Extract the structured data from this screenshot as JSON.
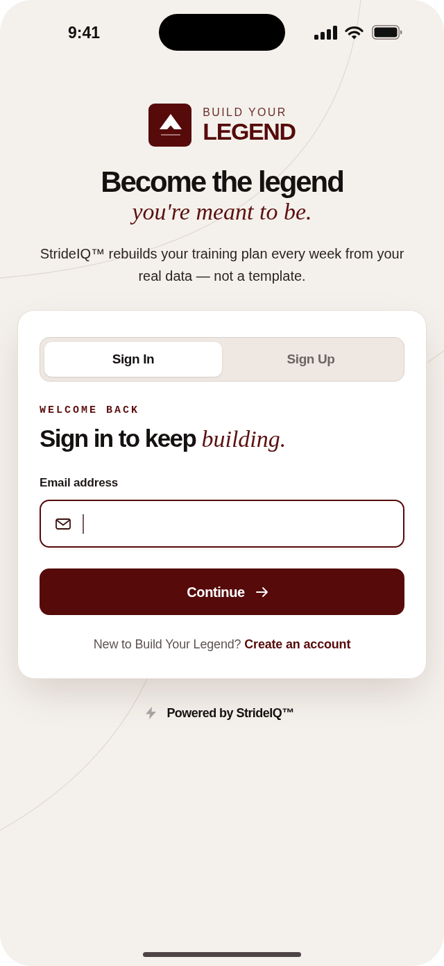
{
  "status_bar": {
    "time": "9:41"
  },
  "brand": {
    "eyebrow": "BUILD YOUR",
    "name": "LEGEND"
  },
  "hero": {
    "headline": "Become the legend",
    "tagline": "you're meant to be.",
    "description": "StrideIQ™ rebuilds your training plan every week from your real data — not a template."
  },
  "auth_card": {
    "tabs": [
      {
        "label": "Sign In",
        "selected": true
      },
      {
        "label": "Sign Up",
        "selected": false
      }
    ],
    "eyebrow": "WELCOME BACK",
    "title": "Sign in to keep *building.*",
    "email_field": {
      "label": "Email address",
      "focused": true
    },
    "submit_button": "Continue",
    "footer": {
      "prompt": "New to Build Your Legend?",
      "link": "Create an account"
    }
  },
  "powered_by": "Powered by StrideIQ™"
}
